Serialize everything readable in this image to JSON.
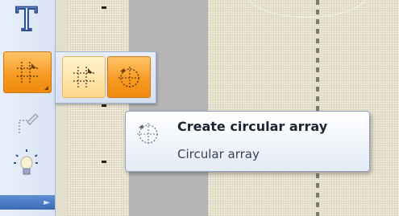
{
  "toolbar": {
    "tools": [
      {
        "icon": "text-tool-icon",
        "label": "T",
        "active": false
      },
      {
        "icon": "array-tool-icon",
        "active": true
      },
      {
        "icon": "angle-brush-icon",
        "active": false
      },
      {
        "icon": "lightbulb-icon",
        "active": false
      }
    ],
    "more_glyph": "►"
  },
  "flyout": {
    "buttons": [
      {
        "icon": "rectangular-array-icon",
        "state": "hover"
      },
      {
        "icon": "circular-array-icon",
        "state": "selected"
      }
    ]
  },
  "tooltip": {
    "title": "Create circular array",
    "subtitle": "Circular array",
    "icon": "circular-array-icon"
  },
  "colors": {
    "accent_orange": "#f6981f",
    "toolbar_blue": "#3c6bb5",
    "canvas_gray": "#b5b5b5"
  }
}
